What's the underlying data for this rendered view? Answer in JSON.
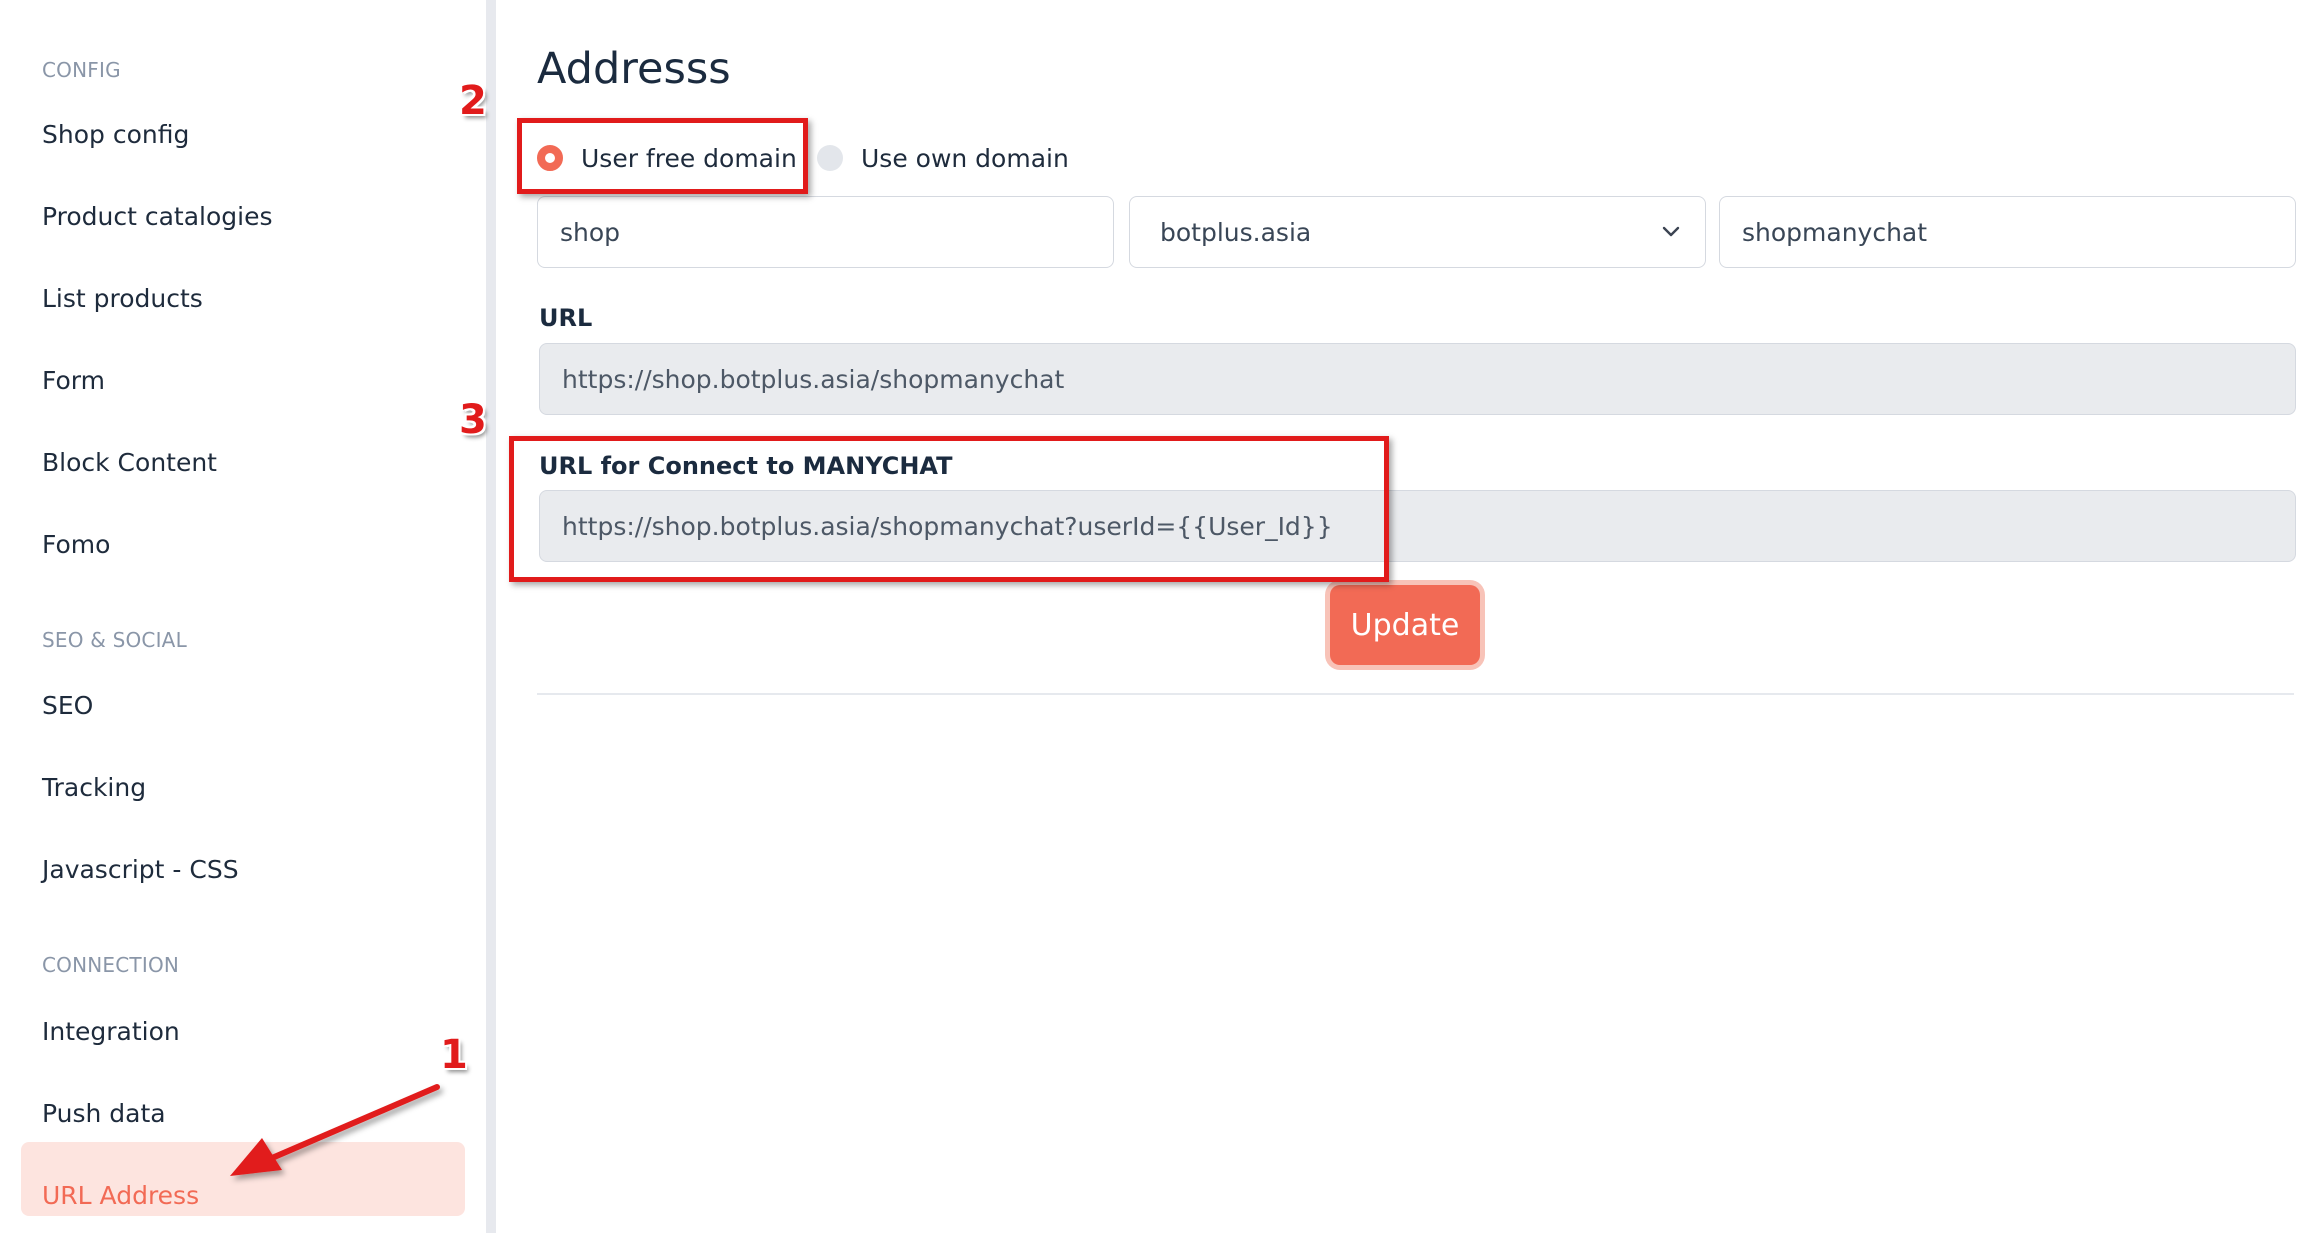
{
  "sidebar": {
    "sections": [
      {
        "label": "CONFIG"
      },
      {
        "label": "SEO & SOCIAL"
      },
      {
        "label": "CONNECTION"
      }
    ],
    "items": [
      {
        "label": "Shop config"
      },
      {
        "label": "Product catalogies"
      },
      {
        "label": "List products"
      },
      {
        "label": "Form"
      },
      {
        "label": "Block Content"
      },
      {
        "label": "Fomo"
      },
      {
        "label": "SEO"
      },
      {
        "label": "Tracking"
      },
      {
        "label": "Javascript - CSS"
      },
      {
        "label": "Integration"
      },
      {
        "label": "Push data"
      },
      {
        "label": "URL Address",
        "active": true
      }
    ]
  },
  "main": {
    "title": "Addresss",
    "radio": {
      "free_domain_label": "User free domain",
      "own_domain_label": "Use own domain",
      "selected": "free_domain"
    },
    "subdomain_value": "shop",
    "domain_select_value": "botplus.asia",
    "path_value": "shopmanychat",
    "url_label": "URL",
    "url_value": "https://shop.botplus.asia/shopmanychat",
    "connect_label": "URL for Connect to MANYCHAT",
    "connect_value": "https://shop.botplus.asia/shopmanychat?userId={{User_Id}}",
    "update_label": "Update"
  },
  "annotations": {
    "step1": "1",
    "step2": "2",
    "step3": "3"
  },
  "colors": {
    "accent": "#f26a55",
    "annotation": "#e11b1b",
    "active_bg": "#fde4df"
  },
  "icons": [
    "chevron-down-icon",
    "arrow-icon"
  ]
}
